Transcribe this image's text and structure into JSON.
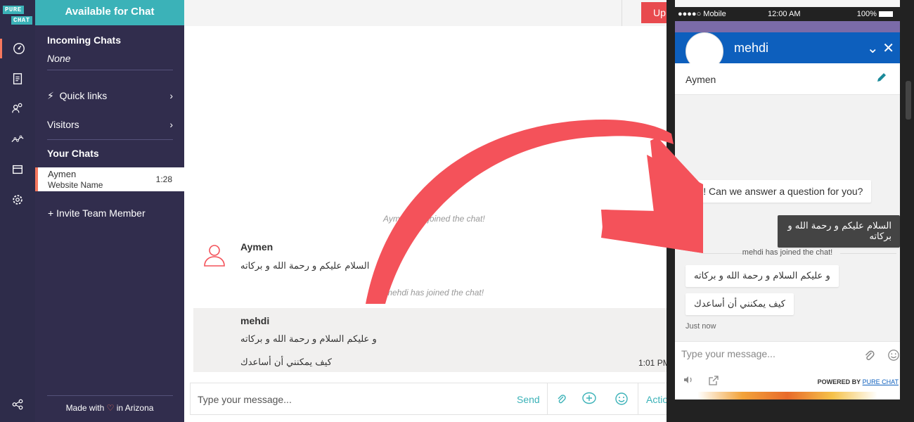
{
  "logo": {
    "line1": "PURE",
    "line2": "CHAT"
  },
  "rail": {
    "icons": [
      "dashboard-icon",
      "transcripts-icon",
      "contacts-icon",
      "analytics-icon",
      "inbox-icon",
      "settings-icon",
      "share-icon"
    ]
  },
  "sidebar": {
    "status": "Available for Chat",
    "incoming_title": "Incoming Chats",
    "incoming_value": "None",
    "quick_links": "Quick links",
    "visitors": "Visitors",
    "your_chats": "Your Chats",
    "chats": [
      {
        "name": "Aymen",
        "site": "Website Name",
        "time": "1:28"
      }
    ],
    "invite": "+ Invite Team Member",
    "footer_pre": "Made with",
    "footer_post": "in Arizona"
  },
  "topbar": {
    "upgrade": "Up"
  },
  "conversation": {
    "system_joined_1": "Aymen has joined the chat!",
    "messages": [
      {
        "name": "Aymen",
        "lines": [
          "السلام عليكم و رحمة الله و بركاته"
        ]
      },
      {
        "name": "mehdi",
        "lines": [
          "و عليكم السلام و رحمة الله و بركاته",
          "كيف يمكنني أن أساعدك"
        ],
        "time": "1:01 PM"
      }
    ],
    "system_joined_2": "mehdi has joined the chat!"
  },
  "input_bar": {
    "placeholder": "Type your message...",
    "send": "Send",
    "actions": "Actions"
  },
  "phone": {
    "status_left": "●●●●○ Mobile",
    "status_time": "12:00 AM",
    "status_right": "100%",
    "operator_name": "mehdi",
    "visitor_name": "Aymen",
    "greeting": "Hi! Can we answer a question for you?",
    "visitor_msg": "السلام عليكم و رحمة الله و بركاته",
    "system": "mehdi has joined the chat!",
    "replies": [
      "و عليكم السلام و رحمة الله و بركاته",
      "كيف يمكنني أن أساعدك"
    ],
    "just_now": "Just now",
    "placeholder": "Type your message...",
    "powered_by": "POWERED BY",
    "powered_link": "PURE CHAT"
  },
  "colors": {
    "accent": "#3bb2b8",
    "sidebar": "#312d4d",
    "rail": "#2e2c4a",
    "arrow": "#f4525a",
    "widget_header": "#0d5fbd"
  }
}
